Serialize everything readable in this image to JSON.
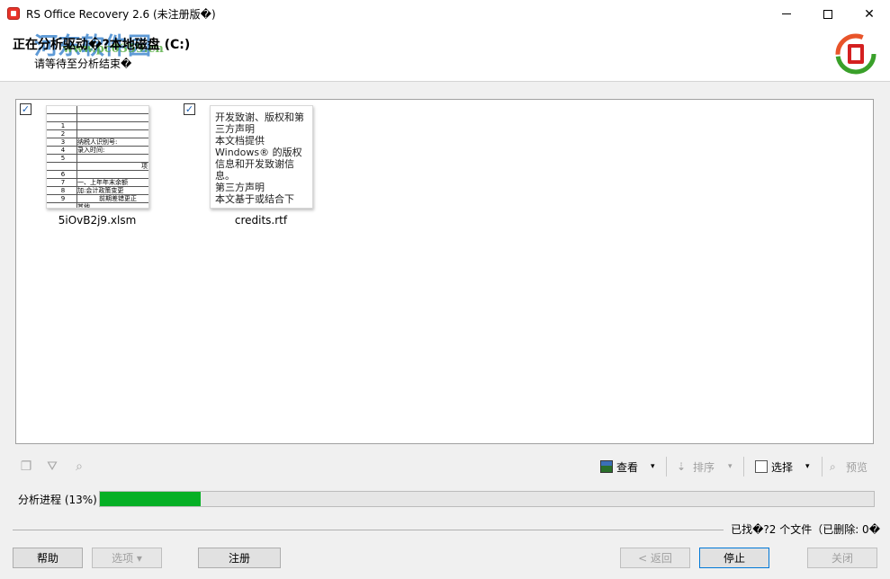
{
  "window": {
    "title": "RS Office Recovery 2.6 (未注册版�)",
    "minimize": "—",
    "close": "✕"
  },
  "header": {
    "title": "正在分析驱动�?本地磁盘 (C:)",
    "subtitle": "请等待至分析结束�",
    "watermark": "河东软件园",
    "watermark_url": "www.pc0359.cn"
  },
  "files": [
    {
      "name": "5iOvB2j9.xlsm",
      "checked": true,
      "thumb_rows": [
        {
          "num": "",
          "text": ""
        },
        {
          "num": "",
          "text": ""
        },
        {
          "num": "1",
          "text": ""
        },
        {
          "num": "2",
          "text": ""
        },
        {
          "num": "3",
          "text": "纳税人识别号:"
        },
        {
          "num": "4",
          "text": "录入时间:"
        },
        {
          "num": "5",
          "text": ""
        },
        {
          "num": "",
          "text": "项"
        },
        {
          "num": "6",
          "text": ""
        },
        {
          "num": "7",
          "text": "一、上年年末余额"
        },
        {
          "num": "8",
          "text": "加:会计政策变更"
        },
        {
          "num": "9",
          "text": "前期差错更正"
        },
        {
          "num": "",
          "text": "其他"
        }
      ]
    },
    {
      "name": "credits.rtf",
      "checked": true,
      "thumb_text": "开发致谢、版权和第三方声明\n本文档提供 Windows® 的版权信息和开发致谢信息。\n第三方声明\n本文基于或结合下"
    }
  ],
  "toolbar": {
    "view_label": "查看",
    "sort_label": "排序",
    "select_label": "选择",
    "preview_label": "预览",
    "dropdown": "▾"
  },
  "progress": {
    "label": "分析进程 (13%)",
    "value": 0.13,
    "color": "#06b025"
  },
  "found_info": "已找�?2 个文件（已删除: 0�",
  "buttons": {
    "help": "帮助",
    "options": "选项 ▾",
    "register": "注册",
    "back": "< 返回",
    "stop": "停止",
    "close": "关闭"
  }
}
